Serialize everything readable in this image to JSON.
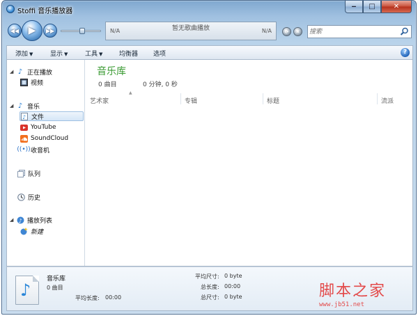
{
  "window": {
    "title": "Stoffi 音乐播放器",
    "min_glyph": "‒",
    "max_glyph": "□",
    "close_glyph": "✕"
  },
  "player": {
    "prev_glyph": "◀◀",
    "play_glyph": "▶",
    "next_glyph": "▶▶",
    "volume_level": 0.55,
    "left_label": "N/A",
    "now_playing": "暂无歌曲播放",
    "right_label": "N/A",
    "search_placeholder": "搜索"
  },
  "menu": {
    "add": "添加",
    "display": "显示",
    "tools": "工具",
    "equalizer": "均衡器",
    "options": "选项",
    "help_glyph": "?"
  },
  "sidebar": {
    "now_playing": "正在播放",
    "video": "视频",
    "music": "音乐",
    "files": "文件",
    "youtube": "YouTube",
    "soundcloud": "SoundCloud",
    "radio": "收音机",
    "queue": "队列",
    "history": "历史",
    "playlists": "播放列表",
    "new": "新建"
  },
  "library": {
    "title": "音乐库",
    "count": "0 曲目",
    "duration": "0 分钟, 0 秒",
    "columns": [
      "艺术家",
      "专辑",
      "标题",
      "流派"
    ]
  },
  "details": {
    "name": "音乐库",
    "count": "0 曲目",
    "avg_length_label": "平均长度:",
    "avg_length": "00:00",
    "avg_size_label": "平均尺寸:",
    "avg_size": "0 byte",
    "total_length_label": "总长度:",
    "total_length": "00:00",
    "total_size_label": "总尺寸:",
    "total_size": "0 byte"
  },
  "watermark": {
    "text": "脚本之家",
    "url": "www.jb51.net"
  },
  "colors": {
    "accent_green": "#3a9a32",
    "selection_blue": "#d5e6f7",
    "watermark_red": "#e34a4a"
  }
}
